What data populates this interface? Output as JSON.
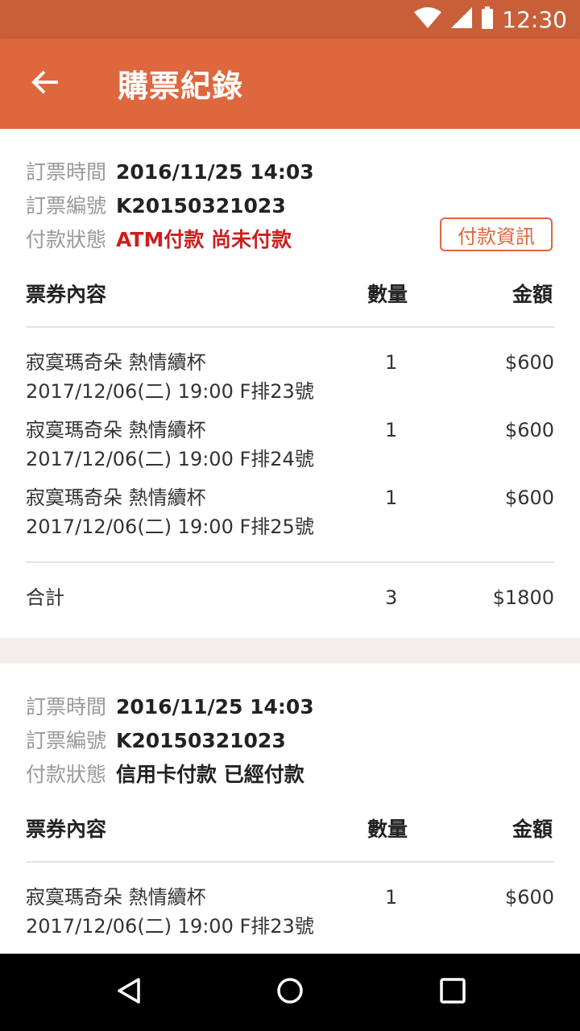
{
  "status_bar": {
    "time": "12:30"
  },
  "app_bar": {
    "title": "購票紀錄"
  },
  "orders": [
    {
      "order_time_label": "訂票時間",
      "order_time": "2016/11/25 14:03",
      "order_no_label": "訂票編號",
      "order_no": "K20150321023",
      "pay_status_label": "付款狀態",
      "pay_status": "ATM付款 尚未付款",
      "pay_info_button": "付款資訊",
      "col_item": "票券內容",
      "col_qty": "數量",
      "col_amount": "金額",
      "tickets": [
        {
          "name": "寂寞瑪奇朵 熱情續杯",
          "detail": "2017/12/06(二) 19:00 F排23號",
          "qty": "1",
          "amount": "$600"
        },
        {
          "name": "寂寞瑪奇朵 熱情續杯",
          "detail": "2017/12/06(二) 19:00 F排24號",
          "qty": "1",
          "amount": "$600"
        },
        {
          "name": "寂寞瑪奇朵 熱情續杯",
          "detail": "2017/12/06(二) 19:00 F排25號",
          "qty": "1",
          "amount": "$600"
        }
      ],
      "total_label": "合計",
      "total_qty": "3",
      "total_amount": "$1800"
    },
    {
      "order_time_label": "訂票時間",
      "order_time": "2016/11/25 14:03",
      "order_no_label": "訂票編號",
      "order_no": "K20150321023",
      "pay_status_label": "付款狀態",
      "pay_status": "信用卡付款 已經付款",
      "col_item": "票券內容",
      "col_qty": "數量",
      "col_amount": "金額",
      "tickets": [
        {
          "name": "寂寞瑪奇朵 熱情續杯",
          "detail": "2017/12/06(二) 19:00 F排23號",
          "qty": "1",
          "amount": "$600"
        }
      ]
    }
  ],
  "colors": {
    "status_bar": "#c85f38",
    "app_bar": "#df673e",
    "unpaid": "#cc1f1f",
    "section_divider": "#f2efeb"
  },
  "icons": {
    "back": "arrow-left-icon",
    "wifi": "wifi-icon",
    "signal": "signal-icon",
    "battery": "battery-icon",
    "nav_back": "triangle-back-icon",
    "nav_home": "circle-home-icon",
    "nav_recents": "square-recents-icon"
  }
}
